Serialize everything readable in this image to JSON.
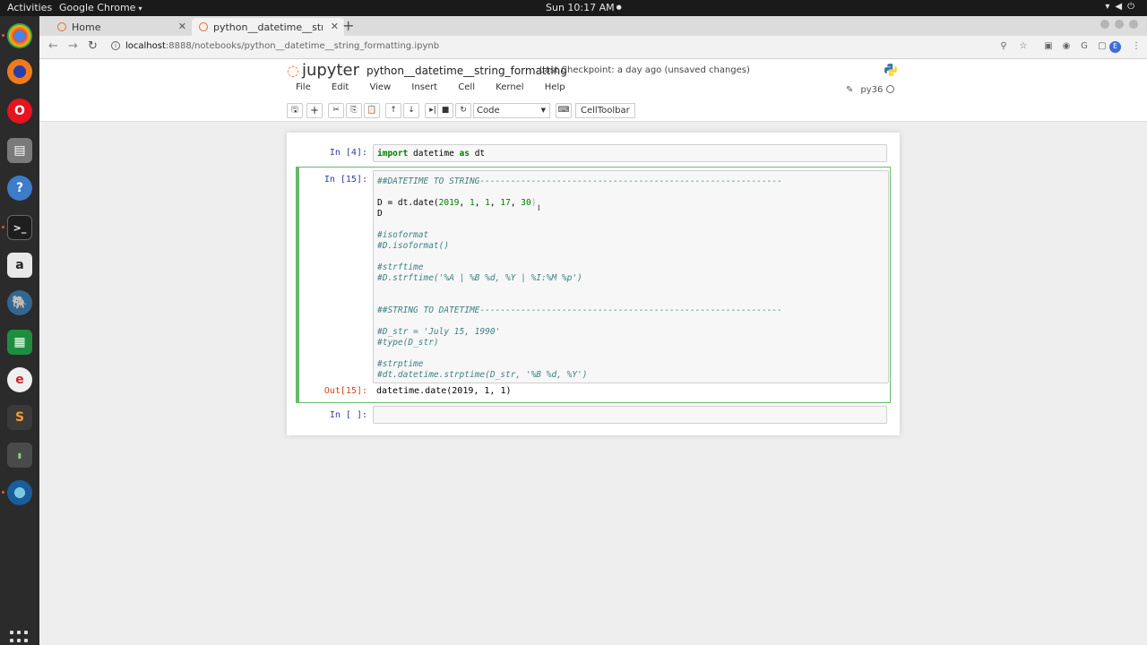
{
  "topbar": {
    "activities": "Activities",
    "app_name": "Google Chrome",
    "clock": "Sun 10:17 AM"
  },
  "browser": {
    "tabs": [
      {
        "label": "Home"
      },
      {
        "label": "python__datetime__string_formatting"
      }
    ],
    "url_host": "localhost",
    "url_path": ":8888/notebooks/python__datetime__string_formatting.ipynb"
  },
  "jupyter": {
    "logo_text": "jupyter",
    "notebook_name": "python__datetime__string_formatting",
    "checkpoint": "Last Checkpoint: a day ago (unsaved changes)",
    "menu": [
      "File",
      "Edit",
      "View",
      "Insert",
      "Cell",
      "Kernel",
      "Help"
    ],
    "kernel_name": "py36",
    "cell_type": "Code",
    "celltoolbar_label": "CellToolbar"
  },
  "cells": {
    "c1": {
      "prompt": "In [4]:",
      "kw1": "import",
      "mid": " datetime ",
      "kw2": "as",
      "end": " dt"
    },
    "c2": {
      "prompt": "In [15]:",
      "l1": "##DATETIME TO STRING-----------------------------------------------------------",
      "l3a": "D = dt.date(",
      "l3n1": "2019",
      "l3s1": ", ",
      "l3n2": "1",
      "l3s2": ", ",
      "l3n3": "1",
      "l3s3": ", ",
      "l3n4": "17",
      "l3s4": ", ",
      "l3n5": "30",
      "l3e": ")",
      "l4": "D",
      "l6": "#isoformat",
      "l7": "#D.isoformat()",
      "l9": "#strftime",
      "l10": "#D.strftime('%A | %B %d, %Y | %I:%M %p')",
      "l13": "##STRING TO DATETIME-----------------------------------------------------------",
      "l15": "#D_str = 'July 15, 1990'",
      "l16": "#type(D_str)",
      "l18": "#strptime",
      "l19": "#dt.datetime.strptime(D_str, '%B %d, %Y')",
      "out_prompt": "Out[15]:",
      "output": "datetime.date(2019, 1, 1)"
    },
    "c3": {
      "prompt": "In [ ]:"
    }
  },
  "colors": {
    "prompt_in": "#303f9f",
    "prompt_out": "#d84315",
    "edit_border": "#66bb6a",
    "jupyter_orange": "#f37726"
  }
}
